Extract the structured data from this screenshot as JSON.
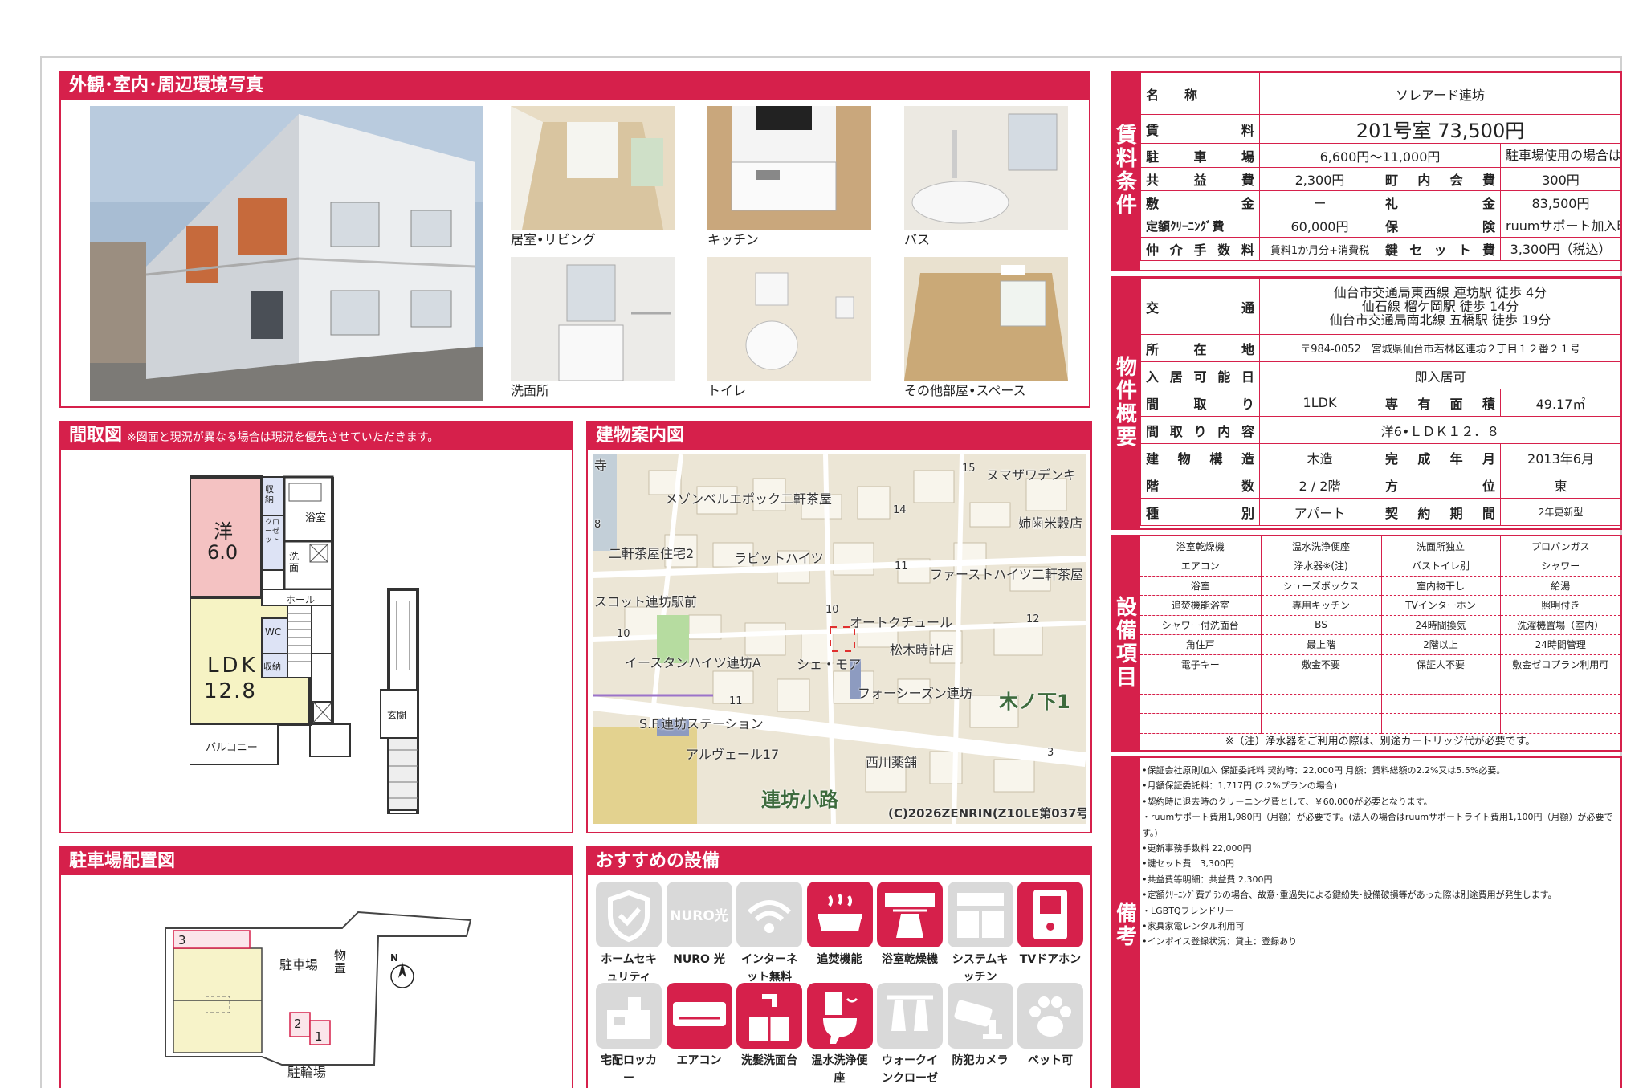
{
  "colors": {
    "accent": "#d6204b"
  },
  "photos": {
    "header": "外観･室内･周辺環境写真",
    "thumbs": [
      {
        "label": "居室•リビング"
      },
      {
        "label": "キッチン"
      },
      {
        "label": "バス"
      },
      {
        "label": "洗面所"
      },
      {
        "label": "トイレ"
      },
      {
        "label": "その他部屋•スペース"
      }
    ]
  },
  "floorplan": {
    "header": "間取図",
    "note": "※図面と現況が異なる場合は現況を優先させていただきます。",
    "rooms": {
      "western": "洋",
      "western_size": "6.0",
      "ldk": "LDK",
      "ldk_size": "12.8",
      "storage": "収納",
      "closet": "クローゼット",
      "bath": "浴室",
      "washroom": "洗面",
      "hall": "ホール",
      "wc": "WC",
      "storage2": "収納",
      "balcony": "バルコニー",
      "entrance": "玄関"
    }
  },
  "map": {
    "header": "建物案内図",
    "labels": [
      "寺",
      "ヌマザワデンキ",
      "メゾンベルエポック二軒茶屋",
      "姉歯米穀店",
      "二軒茶屋住宅2",
      "ラビットハイツ",
      "ファーストハイツ二軒茶屋",
      "スコット連坊駅前",
      "オートクチュール",
      "松木時計店",
      "イースタンハイツ連坊A",
      "シェ・モア",
      "フォーシーズン連坊",
      "木ノ下1",
      "S.F.連坊ステーション",
      "アルヴェール17",
      "西川薬舗",
      "連坊小路",
      "(C)2026ZENRIN(Z10LE第037号)"
    ],
    "numbers": [
      "15",
      "14",
      "11",
      "10",
      "12",
      "10",
      "11",
      "3",
      "8"
    ]
  },
  "parking": {
    "header": "駐車場配置図",
    "labels": {
      "parking": "駐車場",
      "storage": "物置",
      "bike": "駐輪場",
      "north": "N"
    },
    "spots": [
      "3",
      "2",
      "1"
    ]
  },
  "equipment": {
    "header": "おすすめの設備",
    "items": [
      {
        "label": "ホームセキュリティ",
        "icon": "shield-icon",
        "on": false
      },
      {
        "label": "NURO 光",
        "icon": "nuro-icon",
        "on": false,
        "mark": "NURO光"
      },
      {
        "label": "インターネット無料",
        "icon": "wifi-icon",
        "on": false
      },
      {
        "label": "追焚機能",
        "icon": "bathtub-icon",
        "on": true
      },
      {
        "label": "浴室乾燥機",
        "icon": "bath-dryer-icon",
        "on": true
      },
      {
        "label": "システムキッチン",
        "icon": "kitchen-icon",
        "on": false
      },
      {
        "label": "TVドアホン",
        "icon": "intercom-icon",
        "on": true
      },
      {
        "label": "宅配ロッカー",
        "icon": "locker-icon",
        "on": false
      },
      {
        "label": "エアコン",
        "icon": "aircon-icon",
        "on": true
      },
      {
        "label": "洗髪洗面台",
        "icon": "washbasin-icon",
        "on": true
      },
      {
        "label": "温水洗浄便座",
        "icon": "toilet-icon",
        "on": true
      },
      {
        "label": "ウォークインクローゼット",
        "icon": "closet-icon",
        "on": false
      },
      {
        "label": "防犯カメラ",
        "icon": "camera-icon",
        "on": false
      },
      {
        "label": "ペット可",
        "icon": "paw-icon",
        "on": false
      }
    ]
  },
  "rent": {
    "side": [
      "賃",
      "料",
      "条",
      "件"
    ],
    "name_label": "名　　称",
    "name": "ソレアード連坊",
    "rent_label": "賃料",
    "rent": "201号室 73,500円",
    "parking_label": "駐車場",
    "parking": "6,600円～11,000円",
    "parking_note": "駐車場使用の場合は、別途手数料（駐車料+消費税）が必要です。",
    "common_label": "共益費",
    "common": "2,300円",
    "town_label": "町内会費",
    "town": "300円",
    "deposit_label": "敷金",
    "deposit": "ー",
    "key_money_label": "礼金",
    "key_money": "83,500円",
    "cleaning_label": "定額ｸﾘｰﾆﾝｸﾞ費",
    "cleaning": "60,000円",
    "insurance_label": "保険",
    "insurance": "ruumサポート加入時は不要",
    "brokerage_label": "仲介手数料",
    "brokerage": "賃料1か月分+消費税",
    "keyset_label": "鍵セット費",
    "keyset": "3,300円（税込）"
  },
  "property": {
    "side": [
      "物",
      "件",
      "概",
      "要"
    ],
    "access_label": "交通",
    "access": [
      "仙台市交通局東西線 連坊駅 徒歩 4分",
      "仙石線 榴ケ岡駅 徒歩 14分",
      "仙台市交通局南北線 五橋駅 徒歩 19分"
    ],
    "address_label": "所在地",
    "address": "〒984-0052　宮城県仙台市若林区連坊２丁目１２番２１号",
    "movein_label": "入居可能日",
    "movein": "即入居可",
    "layout_label": "間取り",
    "layout": "1LDK",
    "area_label": "専有面積",
    "area": "49.17㎡",
    "detail_label": "間取り内容",
    "detail": "洋6•ＬＤＫ１２．８",
    "structure_label": "建物構造",
    "structure": "木造",
    "built_label": "完成年月",
    "built": "2013年6月",
    "floors_label": "階数",
    "floors": "2 / 2階",
    "direction_label": "方位",
    "direction": "東",
    "type_label": "種別",
    "type": "アパート",
    "contract_label": "契約期間",
    "contract": "2年更新型"
  },
  "facilities": {
    "side": [
      "設",
      "備",
      "項",
      "目"
    ],
    "rows": [
      [
        "浴室乾燥機",
        "温水洗浄便座",
        "洗面所独立",
        "プロパンガス"
      ],
      [
        "エアコン",
        "浄水器※(注)",
        "バストイレ別",
        "シャワー"
      ],
      [
        "浴室",
        "シューズボックス",
        "室内物干し",
        "給湯"
      ],
      [
        "追焚機能浴室",
        "専用キッチン",
        "TVインターホン",
        "照明付き"
      ],
      [
        "シャワー付洗面台",
        "BS",
        "24時間換気",
        "洗濯機置場（室内）"
      ],
      [
        "角住戸",
        "最上階",
        "2階以上",
        "24時間管理"
      ],
      [
        "電子キー",
        "敷金不要",
        "保証人不要",
        "敷金ゼロプラン利用可"
      ],
      [
        "",
        "",
        "",
        ""
      ],
      [
        "",
        "",
        "",
        ""
      ],
      [
        "",
        "",
        "",
        ""
      ]
    ],
    "footnote": "※（注）浄水器をご利用の際は、別途カートリッジ代が必要です。"
  },
  "remarks": {
    "side": [
      "備",
      "考"
    ],
    "lines": [
      "•保証会社原則加入 保証委託料 契約時：22,000円 月額：賃料総額の2.2%又は5.5%必要。",
      "•月額保証委託料：1,717円 (2.2%プランの場合)",
      "•契約時に退去時のクリーニング費として、￥60,000が必要となります。",
      "・ruumサポート費用1,980円（月額）が必要です。(法人の場合はruumサポートライト費用1,100円（月額）が必要です。)",
      "•更新事務手数料 22,000円",
      "•鍵セット費　3,300円",
      "•共益費等明細：共益費 2,300円",
      "•定額ｸﾘｰﾆﾝｸﾞ費ﾌﾟﾗﾝの場合、故意･重過失による鍵紛失･設備破損等があった際は別途費用が発生します。",
      "・LGBTQフレンドリー",
      "•家具家電レンタル利用可",
      "•インボイス登録状況：貸主：登録あり"
    ]
  }
}
